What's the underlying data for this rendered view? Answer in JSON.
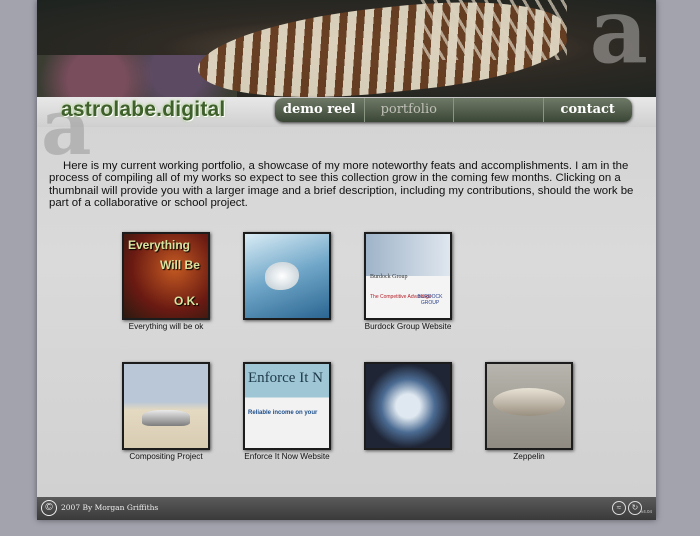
{
  "header": {
    "logo_text": "astrolabe.digital",
    "nav": [
      {
        "label": "demo reel"
      },
      {
        "label": "portfolio"
      },
      {
        "label": ""
      },
      {
        "label": "contact"
      }
    ]
  },
  "intro": "Here is my current working portfolio, a showcase of my more noteworthy feats and accomplishments. I am in the process of compiling all of my works so expect to see this collection grow in the coming few months. Clicking on a thumbnail will provide you with a larger image and a brief description, including my contributions, should the work be part of a collaborative or school project.",
  "thumbnails": [
    {
      "caption": "Everything will be ok",
      "image_text_1": "Everything",
      "image_text_2": "Will Be",
      "image_text_3": "O.K."
    },
    {
      "caption": ""
    },
    {
      "caption": "Burdock Group Website",
      "image_text_1": "Burdock Group",
      "image_text_2": "The Competitive Advantage",
      "image_text_3": "BURDOCK GROUP"
    },
    {
      "caption": "Compositing Project"
    },
    {
      "caption": "Enforce It Now Website",
      "image_text_1": "Enforce It N",
      "image_text_2": "Reliable income on your"
    },
    {
      "caption": ""
    },
    {
      "caption": "Zeppelin"
    }
  ],
  "footer": {
    "copyright_symbol": "©",
    "text": "2007 By Morgan Griffiths",
    "icon1": "≈",
    "icon2": "↻",
    "version": "v4.04"
  },
  "colors": {
    "background": "#a3a3ae",
    "logo": "#3f5f2c",
    "nav_bar": "#4a5545",
    "footer": "#4a4a4a"
  },
  "icons": [
    "copyright-icon",
    "itunes-icon",
    "refresh-icon"
  ]
}
